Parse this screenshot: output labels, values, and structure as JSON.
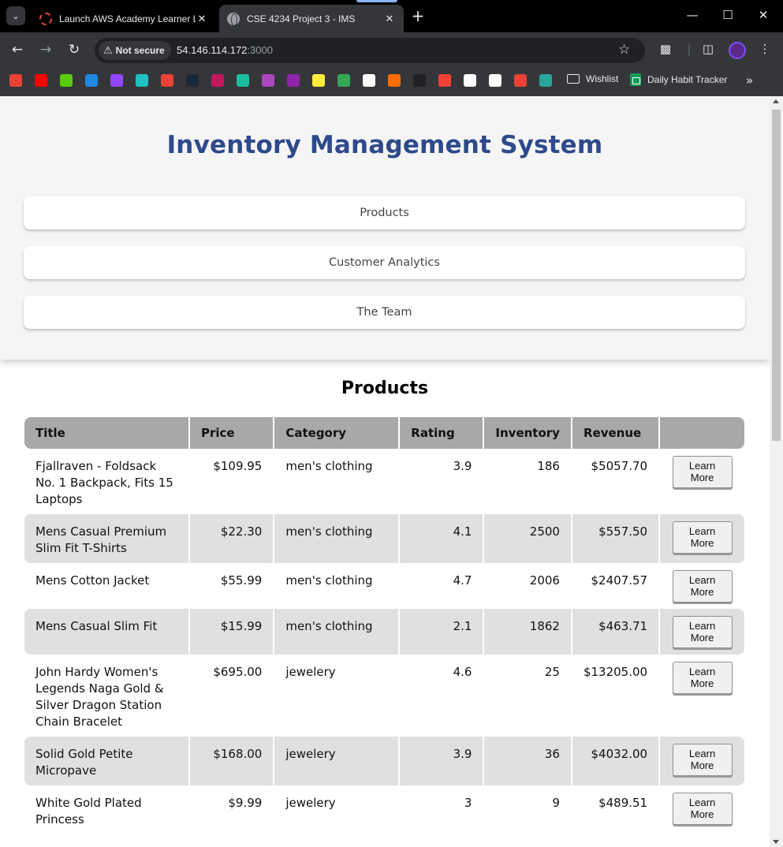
{
  "browser": {
    "tabs": [
      {
        "title": "Launch AWS Academy Learner L",
        "active": false
      },
      {
        "title": "CSE 4234 Project 3 - IMS",
        "active": true
      }
    ],
    "security_label": "Not secure",
    "url_host": "54.146.114.172",
    "url_port": ":3000",
    "bookmarks": {
      "folder_label": "Wishlist",
      "sheet_label": "Daily Habit Tracker",
      "icon_colors": [
        "#ea4335",
        "#ff0000",
        "#58cc02",
        "#1e88e5",
        "#9146ff",
        "#22c1c3",
        "#ea4335",
        "#1b2838",
        "#c2185b",
        "#1abc9c",
        "#ab47bc",
        "#8e24aa",
        "#ffeb3b",
        "#34a853",
        "#ffffff",
        "#ff6d00",
        "#202124",
        "#f44336",
        "#ffffff",
        "#ffffff",
        "#ea4335",
        "#26a69a"
      ]
    }
  },
  "app": {
    "title": "Inventory Management System",
    "nav": [
      "Products",
      "Customer Analytics",
      "The Team"
    ]
  },
  "products": {
    "heading": "Products",
    "columns": [
      "Title",
      "Price",
      "Category",
      "Rating",
      "Inventory",
      "Revenue",
      ""
    ],
    "action_label_line1": "Learn",
    "action_label_line2": "More",
    "rows": [
      {
        "title": "Fjallraven - Foldsack No. 1 Backpack, Fits 15 Laptops",
        "price": "$109.95",
        "category": "men's clothing",
        "rating": "3.9",
        "inventory": "186",
        "revenue": "$5057.70"
      },
      {
        "title": "Mens Casual Premium Slim Fit T-Shirts",
        "price": "$22.30",
        "category": "men's clothing",
        "rating": "4.1",
        "inventory": "2500",
        "revenue": "$557.50"
      },
      {
        "title": "Mens Cotton Jacket",
        "price": "$55.99",
        "category": "men's clothing",
        "rating": "4.7",
        "inventory": "2006",
        "revenue": "$2407.57"
      },
      {
        "title": "Mens Casual Slim Fit",
        "price": "$15.99",
        "category": "men's clothing",
        "rating": "2.1",
        "inventory": "1862",
        "revenue": "$463.71"
      },
      {
        "title": "John Hardy Women's Legends Naga Gold & Silver Dragon Station Chain Bracelet",
        "price": "$695.00",
        "category": "jewelery",
        "rating": "4.6",
        "inventory": "25",
        "revenue": "$13205.00"
      },
      {
        "title": "Solid Gold Petite Micropave",
        "price": "$168.00",
        "category": "jewelery",
        "rating": "3.9",
        "inventory": "36",
        "revenue": "$4032.00"
      },
      {
        "title": "White Gold Plated Princess",
        "price": "$9.99",
        "category": "jewelery",
        "rating": "3",
        "inventory": "9",
        "revenue": "$489.51"
      }
    ]
  }
}
